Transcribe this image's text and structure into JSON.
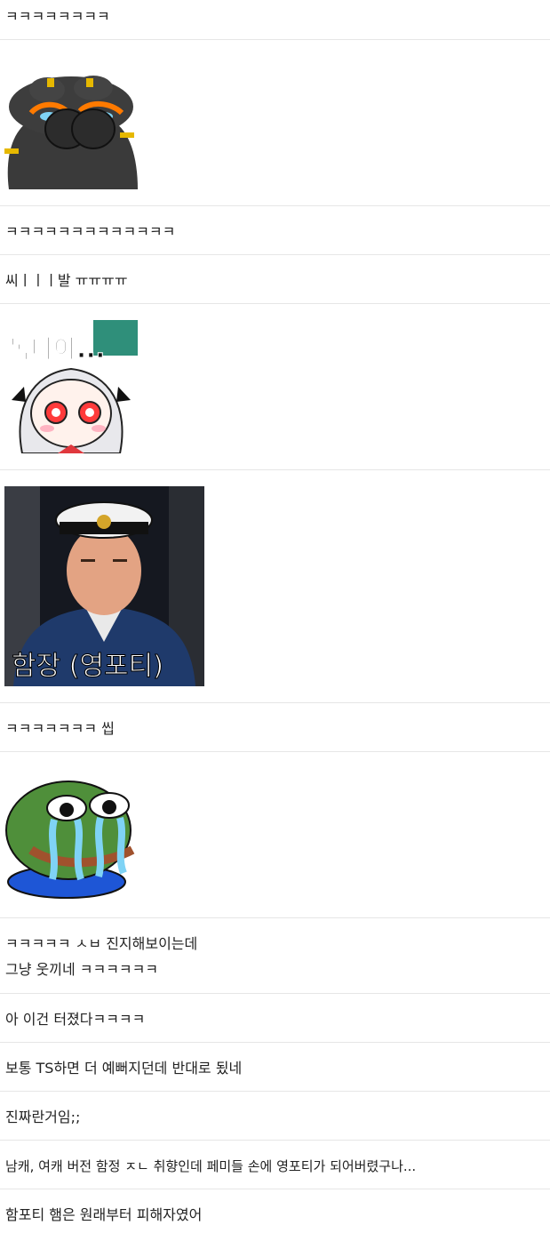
{
  "comments": [
    {
      "text": "ㅋㅋㅋㅋㅋㅋㅋㅋ"
    },
    {
      "sticker": "crying-dark-frog-sticker"
    },
    {
      "text": "ㅋㅋㅋㅋㅋㅋㅋㅋㅋㅋㅋㅋㅋ"
    },
    {
      "text": "씨ㅣㅣㅣ발 ㅠㅠㅠㅠ"
    },
    {
      "sticker": "anime-girl-sticker",
      "caption": "독타아..."
    },
    {
      "sticker": "captain-portrait-sticker",
      "caption": "함장 (영포티)"
    },
    {
      "text": "ㅋㅋㅋㅋㅋㅋㅋ 씹"
    },
    {
      "sticker": "crying-pepe-sticker"
    },
    {
      "text_lines": [
        "ㅋㅋㅋㅋㅋ ㅅㅂ 진지해보이는데",
        "그냥 웃끼네 ㅋㅋㅋㅋㅋㅋ"
      ]
    },
    {
      "text": "아 이건 터졌다ㅋㅋㅋㅋ"
    },
    {
      "text": "보통 TS하면 더 예뻐지던데 반대로 됬네"
    },
    {
      "text": "진짜란거임;;"
    },
    {
      "text": "남캐, 여캐 버전 함정 ㅈㄴ 취향인데 페미들 손에 영포티가 되어버렸구나..."
    },
    {
      "text": "함포티 햄은 원래부터 피해자였어"
    }
  ]
}
